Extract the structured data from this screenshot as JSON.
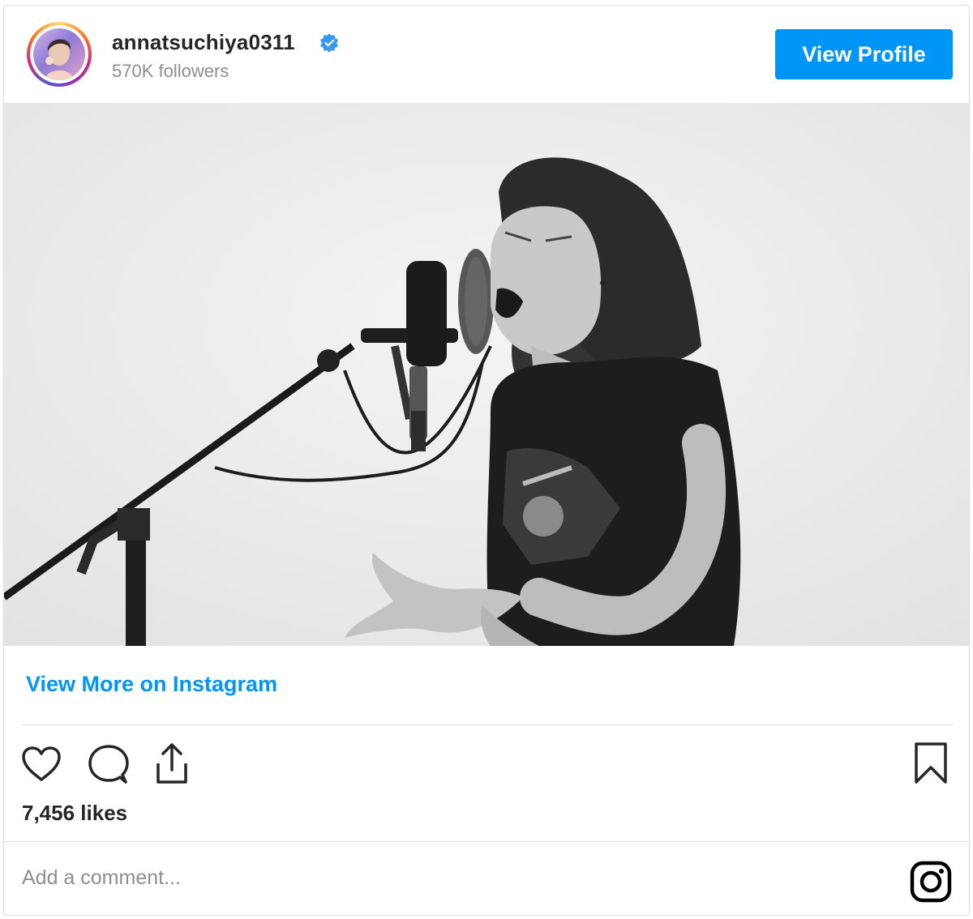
{
  "header": {
    "username": "annatsuchiya0311",
    "followers": "570K followers",
    "view_profile_label": "View Profile"
  },
  "media": {
    "alt": "Black and white photo of a woman singing into a studio microphone with a pop filter"
  },
  "footer": {
    "view_more_label": "View More on Instagram",
    "likes": "7,456 likes",
    "comment_placeholder": "Add a comment..."
  },
  "colors": {
    "accent": "#0095f6",
    "verified": "#3897f0",
    "text": "#262626",
    "muted": "#8e8e8e"
  },
  "icons": [
    "heart-icon",
    "comment-icon",
    "share-icon",
    "bookmark-icon",
    "instagram-icon",
    "verified-icon"
  ]
}
